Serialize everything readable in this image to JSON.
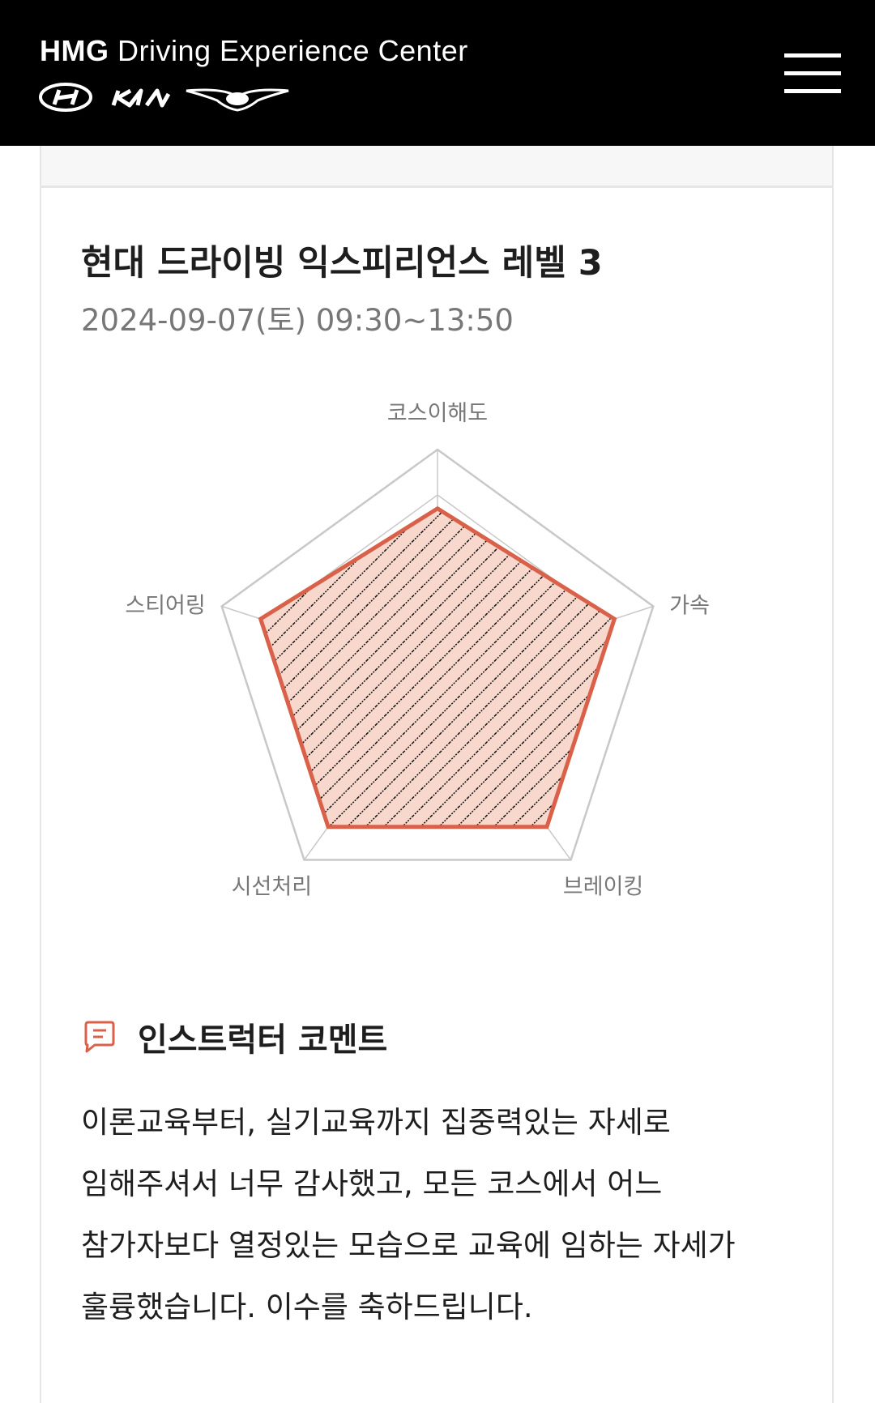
{
  "header": {
    "brand_bold": "HMG",
    "brand_rest": "Driving Experience Center",
    "logos": [
      "hyundai-logo",
      "kia-logo",
      "genesis-logo"
    ],
    "menu_icon": "hamburger-menu-icon"
  },
  "course": {
    "title": "현대 드라이빙 익스피리언스 레벨 3",
    "date": "2024-09-07(토) 09:30~13:50"
  },
  "chart_data": {
    "type": "radar",
    "axes": [
      "코스이해도",
      "가속",
      "브레이킹",
      "시선처리",
      "스티어링"
    ],
    "scale_max": 5,
    "grid_levels": [
      1,
      2,
      3,
      4,
      5
    ],
    "values": [
      3.7,
      4.1,
      4.1,
      4.1,
      4.1
    ],
    "colors": {
      "fill": "#f8d8cd",
      "stroke": "#d9614a",
      "hatch": "#111111",
      "grid": "#c8c8c8"
    }
  },
  "comment": {
    "icon": "chat-bubble-icon",
    "title": "인스트럭터 코멘트",
    "lines": [
      "이론교육부터, 실기교육까지 집중력있는 자세로",
      "임해주셔서 너무 감사했고, 모든 코스에서 어느",
      "참가자보다 열정있는 모습으로 교육에 임하는 자세가",
      "훌륭했습니다. 이수를 축하드립니다."
    ]
  },
  "colors": {
    "header_bg": "#000000",
    "accent": "#d9614a",
    "muted_text": "#777777"
  }
}
